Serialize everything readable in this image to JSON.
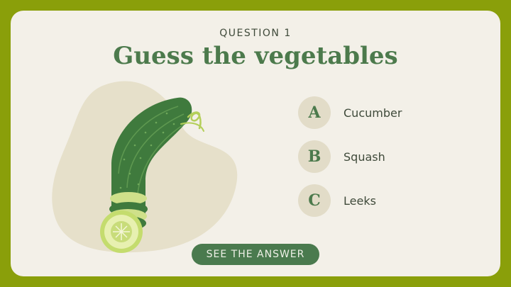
{
  "question": {
    "label": "QUESTION 1",
    "title": "Guess the vegetables"
  },
  "illustration": {
    "icon": "cucumber-icon"
  },
  "options": [
    {
      "letter": "A",
      "text": "Cucumber"
    },
    {
      "letter": "B",
      "text": "Squash"
    },
    {
      "letter": "C",
      "text": "Leeks"
    }
  ],
  "answer_button": {
    "label": "SEE THE ANSWER"
  },
  "colors": {
    "frame": "#8a9f0a",
    "card": "#f3f0e8",
    "accent": "#4c7a4c",
    "badge": "#e2dcc8",
    "blob": "#e6e0ca"
  }
}
